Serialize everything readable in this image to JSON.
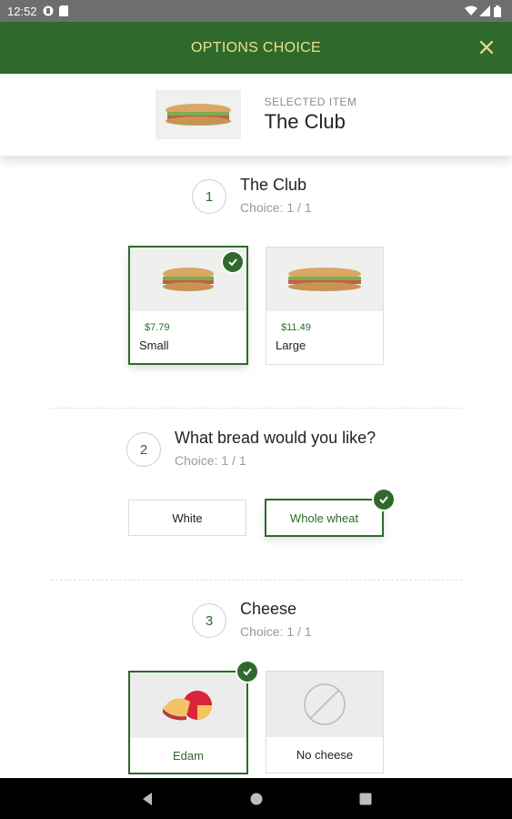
{
  "status": {
    "time": "12:52"
  },
  "header": {
    "title": "OPTIONS CHOICE"
  },
  "selected_item": {
    "eyebrow": "SELECTED ITEM",
    "name": "The Club"
  },
  "steps": [
    {
      "number": "1",
      "title": "The Club",
      "subtitle": "Choice: 1 / 1",
      "options": [
        {
          "price": "$7.79",
          "label": "Small"
        },
        {
          "price": "$11.49",
          "label": "Large"
        }
      ]
    },
    {
      "number": "2",
      "title": "What bread would you like?",
      "subtitle": "Choice: 1 / 1",
      "options": [
        {
          "label": "White"
        },
        {
          "label": "Whole wheat"
        }
      ]
    },
    {
      "number": "3",
      "title": "Cheese",
      "subtitle": "Choice: 1 / 1",
      "options": [
        {
          "label": "Edam"
        },
        {
          "label": "No cheese"
        }
      ]
    }
  ],
  "colors": {
    "brand_green": "#2f6a2c",
    "header_text": "#e9e28a"
  }
}
